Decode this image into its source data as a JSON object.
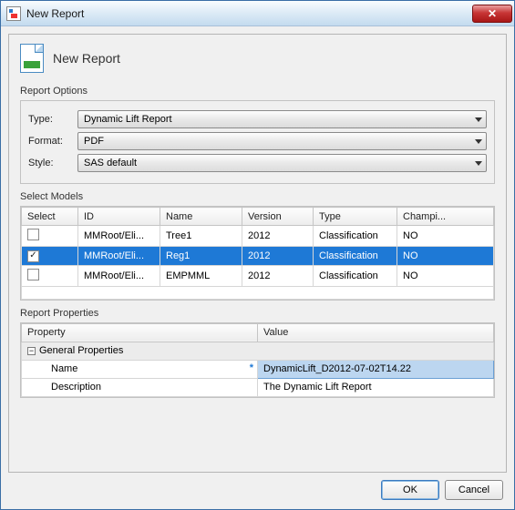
{
  "window": {
    "title": "New Report"
  },
  "header": {
    "title": "New Report"
  },
  "options": {
    "section_label": "Report Options",
    "type_label": "Type:",
    "type_value": "Dynamic Lift Report",
    "format_label": "Format:",
    "format_value": "PDF",
    "style_label": "Style:",
    "style_value": "SAS default"
  },
  "models": {
    "section_label": "Select Models",
    "columns": [
      "Select",
      "ID",
      "Name",
      "Version",
      "Type",
      "Champi..."
    ],
    "rows": [
      {
        "selected": false,
        "id": "MMRoot/Eli...",
        "name": "Tree1",
        "version": "2012",
        "type": "Classification",
        "champion": "NO",
        "highlighted": false
      },
      {
        "selected": true,
        "id": "MMRoot/Eli...",
        "name": "Reg1",
        "version": "2012",
        "type": "Classification",
        "champion": "NO",
        "highlighted": true
      },
      {
        "selected": false,
        "id": "MMRoot/Eli...",
        "name": "EMPMML",
        "version": "2012",
        "type": "Classification",
        "champion": "NO",
        "highlighted": false
      }
    ]
  },
  "properties": {
    "section_label": "Report Properties",
    "columns": [
      "Property",
      "Value"
    ],
    "group_label": "General Properties",
    "rows": [
      {
        "name": "Name",
        "required": true,
        "value": "DynamicLift_D2012-07-02T14.22",
        "value_selected": true
      },
      {
        "name": "Description",
        "required": false,
        "value": "The Dynamic Lift Report",
        "value_selected": false
      }
    ]
  },
  "buttons": {
    "ok": "OK",
    "cancel": "Cancel"
  }
}
